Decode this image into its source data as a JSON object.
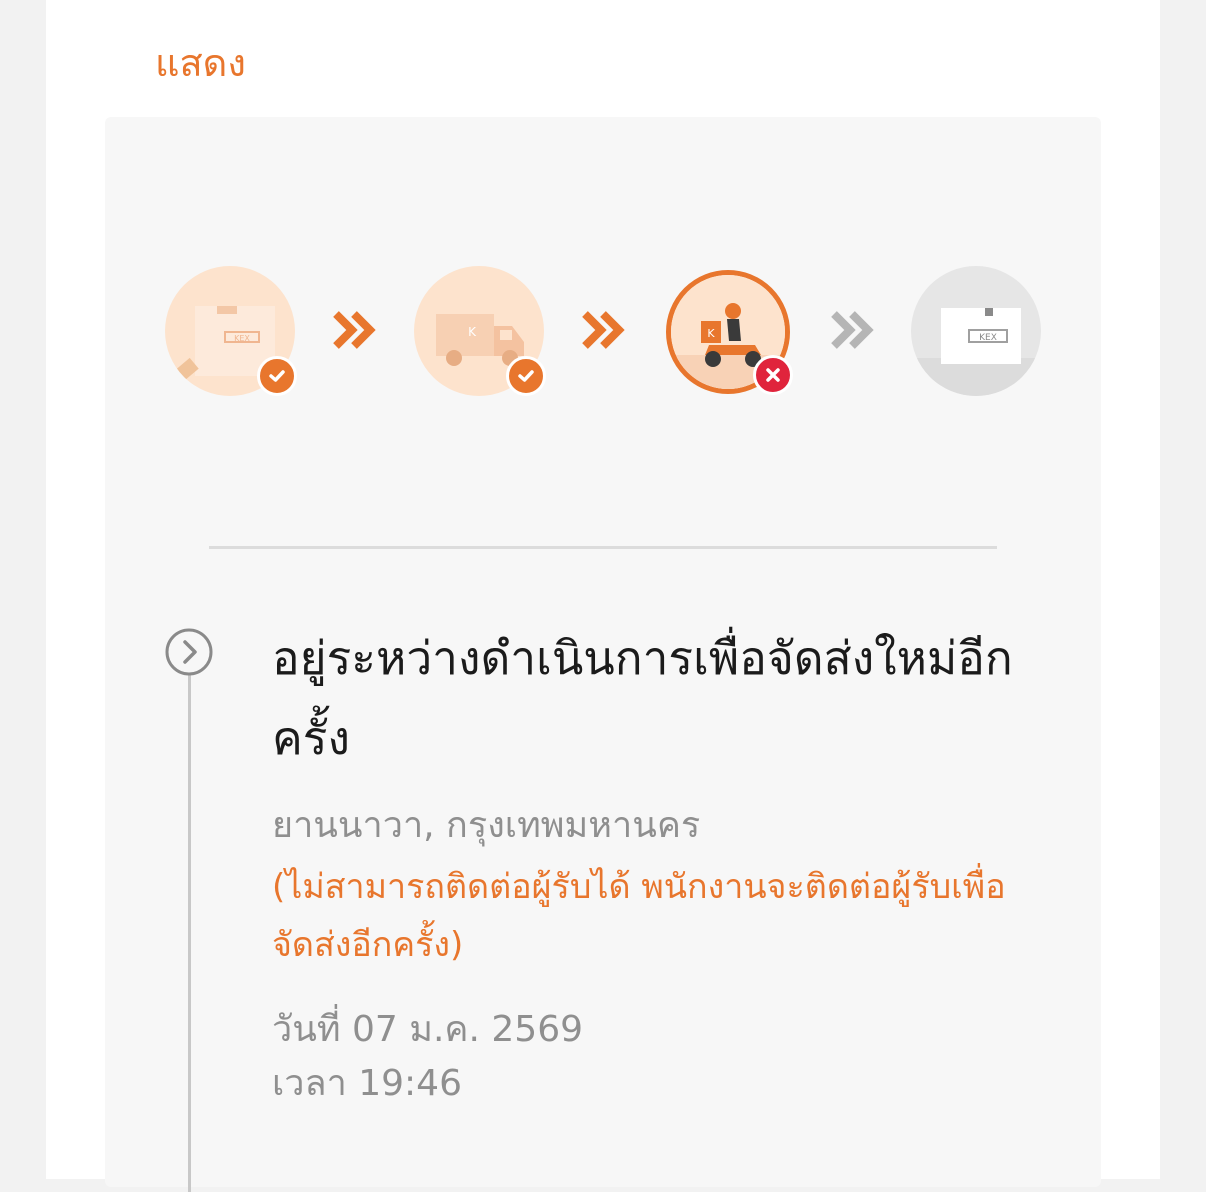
{
  "header": {
    "show_label": "แสดง"
  },
  "progress": {
    "steps": [
      {
        "name": "received",
        "state": "done",
        "icon": "parcel-box-icon"
      },
      {
        "name": "in-transit",
        "state": "done",
        "icon": "delivery-truck-icon"
      },
      {
        "name": "out-for-delivery",
        "state": "failed",
        "icon": "delivery-motorbike-icon"
      },
      {
        "name": "delivered",
        "state": "pending",
        "icon": "parcel-box-icon"
      }
    ],
    "box_brand": "KEX",
    "colors": {
      "accent": "#e8762d",
      "fail": "#e0243c",
      "pending": "#b5b5b5"
    }
  },
  "event": {
    "title": "อยู่ระหว่างดำเนินการเพื่อจัดส่งใหม่อีกครั้ง",
    "location": "ยานนาวา, กรุงเทพมหานคร",
    "note": "(ไม่สามารถติดต่อผู้รับได้ พนักงานจะติดต่อผู้รับเพื่อจัดส่งอีกครั้ง)",
    "date": "วันที่ 07 ม.ค. 2569",
    "time": "เวลา 19:46"
  }
}
